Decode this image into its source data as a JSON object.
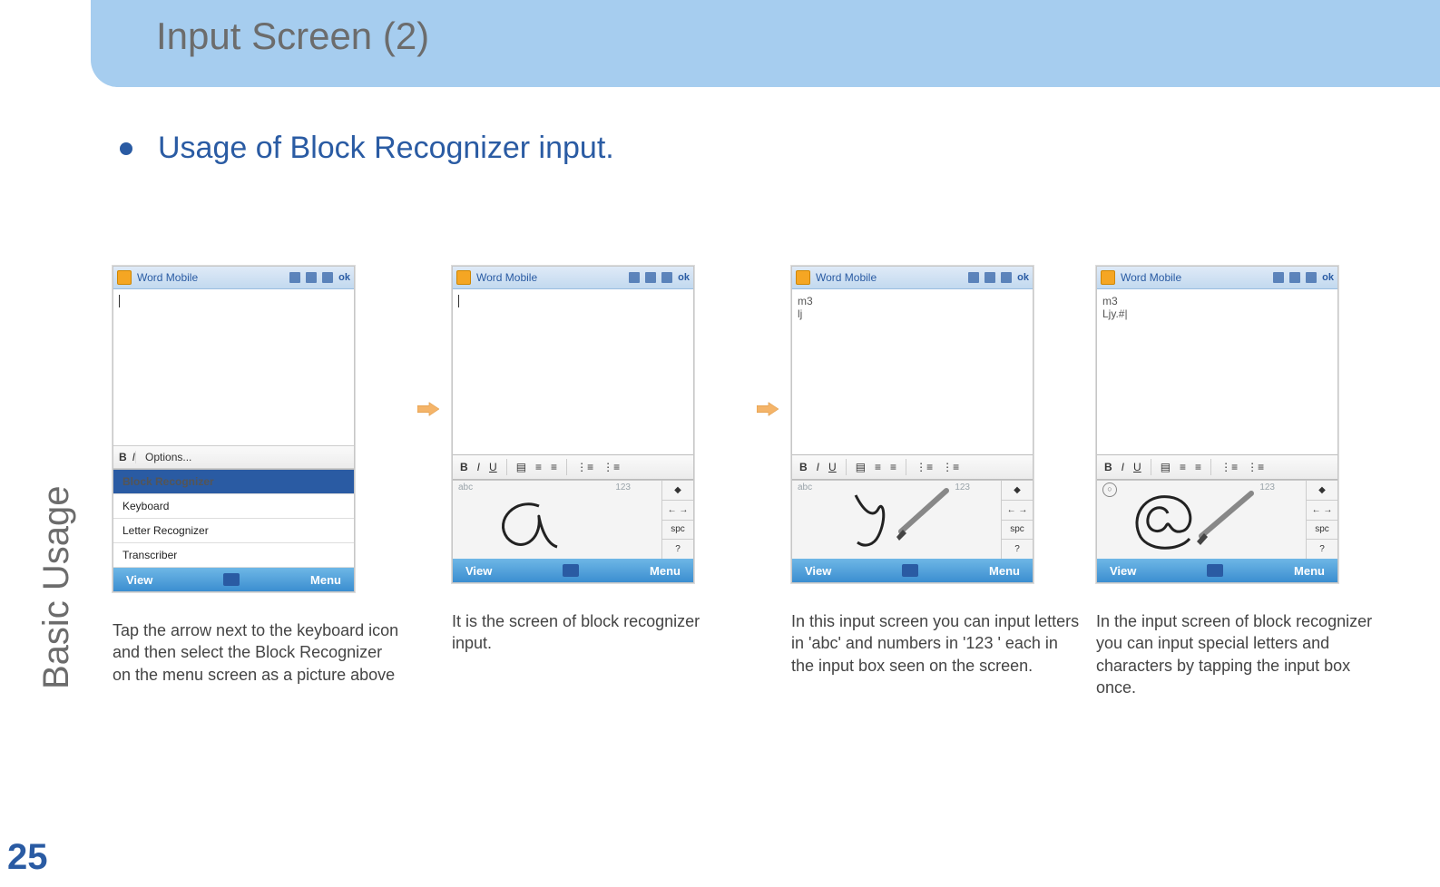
{
  "slide": {
    "title": "Input Screen (2)",
    "side_label": "Basic Usage",
    "page_number": "25",
    "bullet": "Usage of Block Recognizer input."
  },
  "device_common": {
    "app_title": "Word Mobile",
    "ok": "ok",
    "footer_left": "View",
    "footer_right": "Menu",
    "tb": {
      "b": "B",
      "i": "I",
      "u": "U"
    },
    "rec": {
      "hint_abc": "abc",
      "hint_123": "123",
      "spc": "spc",
      "arrows": "← →",
      "enter": "↵",
      "q": "?",
      "bk": "⌫",
      "bullet": "◆"
    }
  },
  "screens": [
    {
      "caption": "Tap the arrow next to the keyboard icon and then select the Block Recognizer on the menu screen as a picture above",
      "opt_btn": "Options...",
      "menu": [
        "Options...",
        "Block Recognizer",
        "Keyboard",
        "Letter Recognizer",
        "Transcriber"
      ],
      "selected": "Block Recognizer"
    },
    {
      "caption": "It is the screen of  block recognizer input.",
      "doc_lines": []
    },
    {
      "caption": "In this input screen you can input letters in 'abc' and numbers in '123 ' each in the input box seen on the screen.",
      "doc_lines": [
        "m3",
        "lj"
      ]
    },
    {
      "caption": "In the input screen of block recognizer you can input special letters and characters by tapping the input box once.",
      "doc_lines": [
        "m3",
        "Ljy.#|"
      ]
    }
  ]
}
